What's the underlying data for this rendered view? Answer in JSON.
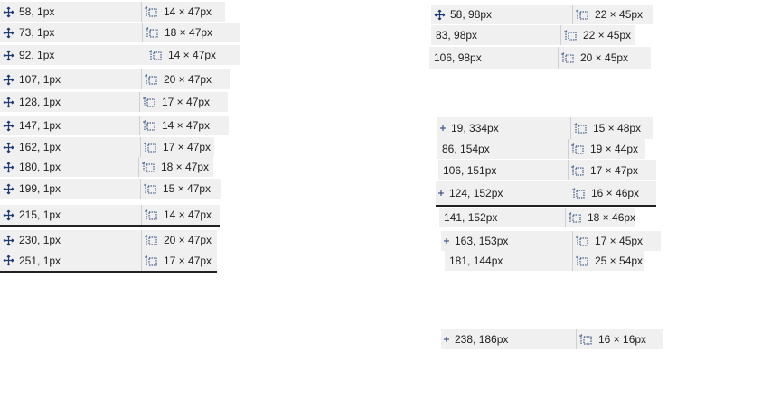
{
  "readouts": [
    {
      "position": "58, 1px",
      "size": "14 × 47px"
    },
    {
      "position": "73, 1px",
      "size": "18 × 47px"
    },
    {
      "position": "92, 1px",
      "size": "14 × 47px"
    },
    {
      "position": "107, 1px",
      "size": "20 × 47px"
    },
    {
      "position": "128, 1px",
      "size": "17 × 47px"
    },
    {
      "position": "147, 1px",
      "size": "14 × 47px"
    },
    {
      "position": "162, 1px",
      "size": "17 × 47px"
    },
    {
      "position": "180, 1px",
      "size": "18 × 47px"
    },
    {
      "position": "199, 1px",
      "size": "15 × 47px"
    },
    {
      "position": "215, 1px",
      "size": "14 × 47px"
    },
    {
      "position": "230, 1px",
      "size": "20 × 47px"
    },
    {
      "position": "251, 1px",
      "size": "17 × 47px"
    },
    {
      "position": "58, 98px",
      "size": "22 × 45px"
    },
    {
      "position": "83, 98px",
      "size": "22 × 45px"
    },
    {
      "position": "106, 98px",
      "size": "20 × 45px"
    },
    {
      "position": "19, 334px",
      "size": "15 × 48px"
    },
    {
      "position": "86, 154px",
      "size": "19 × 44px"
    },
    {
      "position": "106, 151px",
      "size": "17 × 47px"
    },
    {
      "position": "124, 152px",
      "size": "16 × 46px"
    },
    {
      "position": "141, 152px",
      "size": "18 × 46px"
    },
    {
      "position": "163, 153px",
      "size": "17 × 45px"
    },
    {
      "position": "181, 144px",
      "size": "25 × 54px"
    },
    {
      "position": "238, 186px",
      "size": "16 × 16px"
    }
  ]
}
